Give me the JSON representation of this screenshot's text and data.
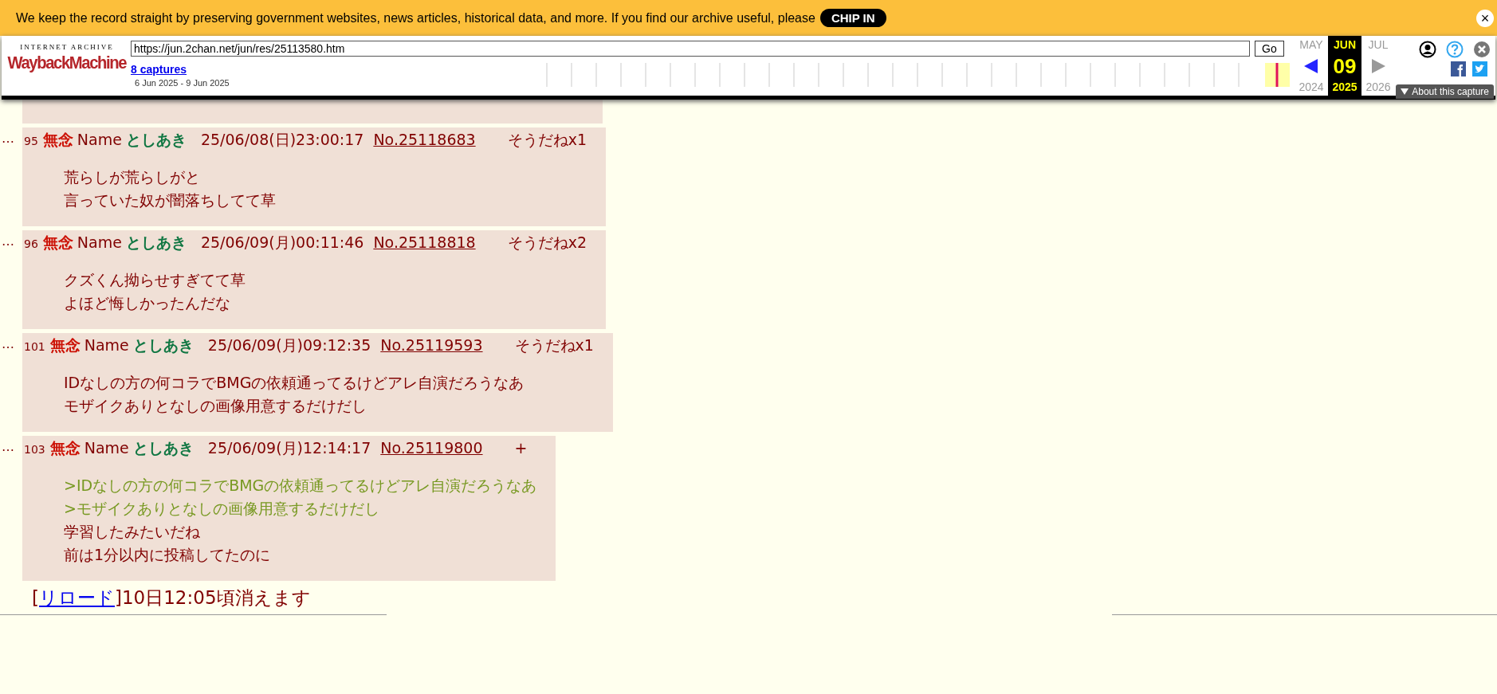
{
  "donation_banner": {
    "message": "We keep the record straight by preserving government websites, news articles, historical data, and more. If you find our archive useful, please",
    "button": "CHIP IN",
    "close": "×"
  },
  "wayback_toolbar": {
    "logo_top": "INTERNET ARCHIVE",
    "logo_main": "WaybackMachine",
    "url": "https://jun.2chan.net/jun/res/25113580.htm",
    "go": "Go",
    "captures": "8 captures",
    "range": "6 Jun 2025 - 9 Jun 2025",
    "calendar": {
      "prev_month": "MAY",
      "month": "JUN",
      "next_month": "JUL",
      "day": "09",
      "prev_year": "2024",
      "year": "2025",
      "next_year": "2026"
    },
    "about": "About this capture"
  },
  "posts": [
    {
      "mark": "…",
      "number": "95",
      "subject": "無念",
      "name_label": "Name",
      "name": "としあき",
      "date": "25/06/08(日)23:00:17",
      "no": "No.25118683",
      "sodane": "そうだねx1",
      "lines": [
        {
          "kind": "text",
          "text": "荒らしが荒らしがと"
        },
        {
          "kind": "text",
          "text": "言っていた奴が闇落ちしてて草"
        }
      ]
    },
    {
      "mark": "…",
      "number": "96",
      "subject": "無念",
      "name_label": "Name",
      "name": "としあき",
      "date": "25/06/09(月)00:11:46",
      "no": "No.25118818",
      "sodane": "そうだねx2",
      "lines": [
        {
          "kind": "text",
          "text": "クズくん拗らせすぎてて草"
        },
        {
          "kind": "text",
          "text": "よほど悔しかったんだな"
        }
      ]
    },
    {
      "mark": "…",
      "number": "101",
      "subject": "無念",
      "name_label": "Name",
      "name": "としあき",
      "date": "25/06/09(月)09:12:35",
      "no": "No.25119593",
      "sodane": "そうだねx1",
      "lines": [
        {
          "kind": "text",
          "text": "IDなしの方の何コラでBMGの依頼通ってるけどアレ自演だろうなあ"
        },
        {
          "kind": "text",
          "text": "モザイクありとなしの画像用意するだけだし"
        }
      ]
    },
    {
      "mark": "…",
      "number": "103",
      "subject": "無念",
      "name_label": "Name",
      "name": "としあき",
      "date": "25/06/09(月)12:14:17",
      "no": "No.25119800",
      "sodane": "+",
      "lines": [
        {
          "kind": "quote",
          "text": ">IDなしの方の何コラでBMGの依頼通ってるけどアレ自演だろうなあ"
        },
        {
          "kind": "quote",
          "text": ">モザイクありとなしの画像用意するだけだし"
        },
        {
          "kind": "text",
          "text": "学習したみたいだね"
        },
        {
          "kind": "text",
          "text": "前は1分以内に投稿してたのに"
        }
      ]
    }
  ],
  "footer": {
    "bracket_open": "[",
    "reload": "リロード",
    "bracket_close": "]",
    "notice": "10日12:05頃消えます"
  }
}
